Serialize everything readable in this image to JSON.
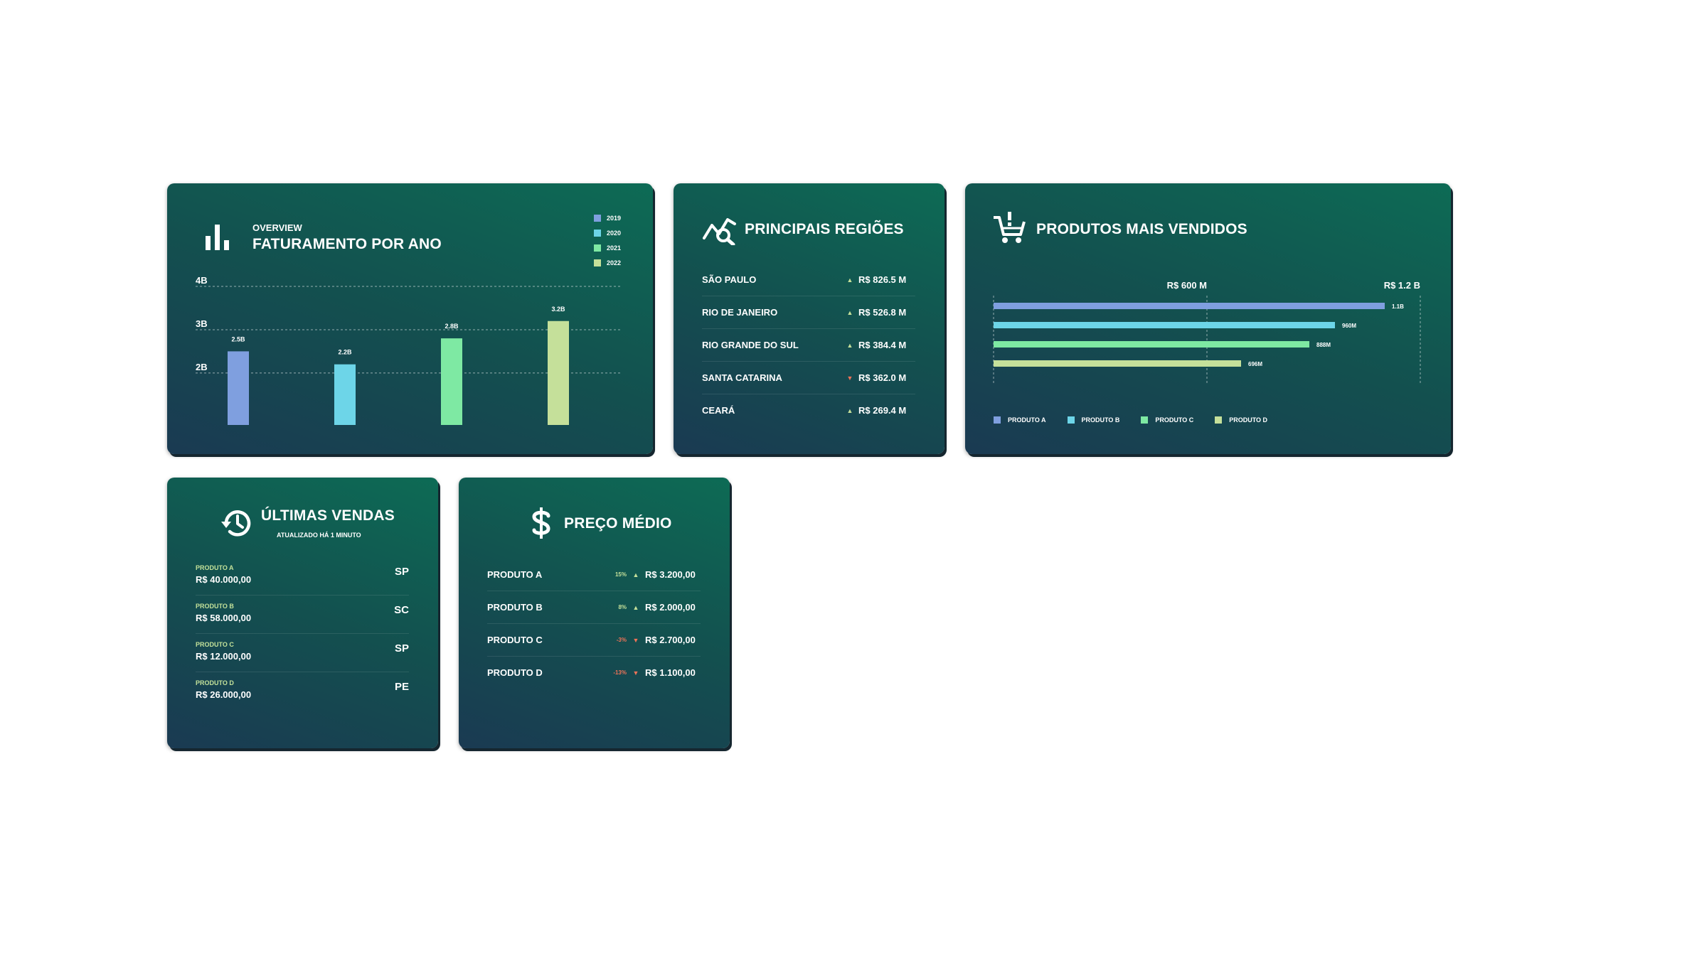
{
  "colors": {
    "produto_a": "#7f9fdf",
    "produto_b": "#6dd5e8",
    "produto_c": "#7ee9a3",
    "produto_d": "#c5e09a",
    "up": "#c5e09a",
    "down": "#f07358"
  },
  "overview": {
    "subtitle": "OVERVIEW",
    "title": "FATURAMENTO POR ANO",
    "icon": "bar-chart-icon",
    "legend": [
      "2019",
      "2020",
      "2021",
      "2022"
    ]
  },
  "regions": {
    "title": "PRINCIPAIS REGIÕES",
    "icon": "trend-search-icon",
    "rows": [
      {
        "name": "SÃO PAULO",
        "trend": "up",
        "value": "R$ 826.5 M"
      },
      {
        "name": "RIO DE JANEIRO",
        "trend": "up",
        "value": "R$ 526.8 M"
      },
      {
        "name": "RIO GRANDE DO SUL",
        "trend": "up",
        "value": "R$ 384.4 M"
      },
      {
        "name": "SANTA CATARINA",
        "trend": "down",
        "value": "R$ 362.0 M"
      },
      {
        "name": "CEARÁ",
        "trend": "up",
        "value": "R$ 269.4 M"
      }
    ]
  },
  "products": {
    "title": "PRODUTOS MAIS VENDIDOS",
    "icon": "shopping-cart-icon",
    "legend": [
      "PRODUTO A",
      "PRODUTO B",
      "PRODUTO C",
      "PRODUTO D"
    ]
  },
  "sales": {
    "title": "ÚLTIMAS VENDAS",
    "subtitle": "ATUALIZADO HÁ 1 MINUTO",
    "icon": "history-icon",
    "rows": [
      {
        "product": "PRODUTO A",
        "value": "R$ 40.000,00",
        "state": "SP"
      },
      {
        "product": "PRODUTO B",
        "value": "R$ 58.000,00",
        "state": "SC"
      },
      {
        "product": "PRODUTO C",
        "value": "R$ 12.000,00",
        "state": "SP"
      },
      {
        "product": "PRODUTO D",
        "value": "R$ 26.000,00",
        "state": "PE"
      }
    ]
  },
  "price": {
    "title": "PREÇO MÉDIO",
    "icon": "dollar-icon",
    "rows": [
      {
        "name": "PRODUTO A",
        "pct": "15%",
        "trend": "up",
        "value": "R$ 3.200,00"
      },
      {
        "name": "PRODUTO B",
        "pct": "8%",
        "trend": "up",
        "value": "R$ 2.000,00"
      },
      {
        "name": "PRODUTO C",
        "pct": "-3%",
        "trend": "down",
        "value": "R$ 2.700,00"
      },
      {
        "name": "PRODUTO D",
        "pct": "-13%",
        "trend": "down",
        "value": "R$ 1.100,00"
      }
    ]
  },
  "chart_data": [
    {
      "type": "bar",
      "title": "FATURAMENTO POR ANO",
      "categories": [
        "2019",
        "2020",
        "2021",
        "2022"
      ],
      "values": [
        2.5,
        2.2,
        2.8,
        3.2
      ],
      "value_labels": [
        "2.5B",
        "2.2B",
        "2.8B",
        "3.2B"
      ],
      "yticks": [
        "2B",
        "3B",
        "4B"
      ],
      "ytick_values": [
        2,
        3,
        4
      ],
      "ylim": [
        0.8,
        4
      ],
      "grid": true
    },
    {
      "type": "bar",
      "orientation": "horizontal",
      "title": "PRODUTOS MAIS VENDIDOS",
      "categories": [
        "PRODUTO A",
        "PRODUTO B",
        "PRODUTO C",
        "PRODUTO D"
      ],
      "values": [
        1100,
        960,
        888,
        696
      ],
      "value_labels": [
        "1.1B",
        "960M",
        "888M",
        "696M"
      ],
      "xticks": [
        "R$ 600 M",
        "R$ 1.2 B"
      ],
      "xtick_values": [
        600,
        1200
      ],
      "xlim": [
        0,
        1200
      ],
      "legend": "bottom",
      "grid": true
    }
  ]
}
